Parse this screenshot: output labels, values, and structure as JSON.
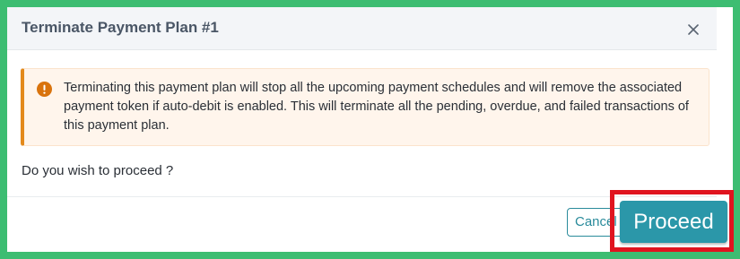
{
  "dialog": {
    "title": "Terminate Payment Plan #1",
    "close_icon": "close-icon"
  },
  "alert": {
    "icon": "exclamation-circle-icon",
    "message": "Terminating this payment plan will stop all the upcoming payment schedules and will remove the associated payment token if auto-debit is enabled. This will terminate all the pending, overdue, and failed transactions of this payment plan."
  },
  "prompt": "Do you wish to proceed ?",
  "footer": {
    "cancel_label": "Cancel",
    "proceed_label": "Proceed"
  },
  "colors": {
    "frame_border": "#3dbd72",
    "alert_accent": "#e38a1c",
    "primary_button": "#2b97a9",
    "highlight_box": "#e0141f"
  }
}
